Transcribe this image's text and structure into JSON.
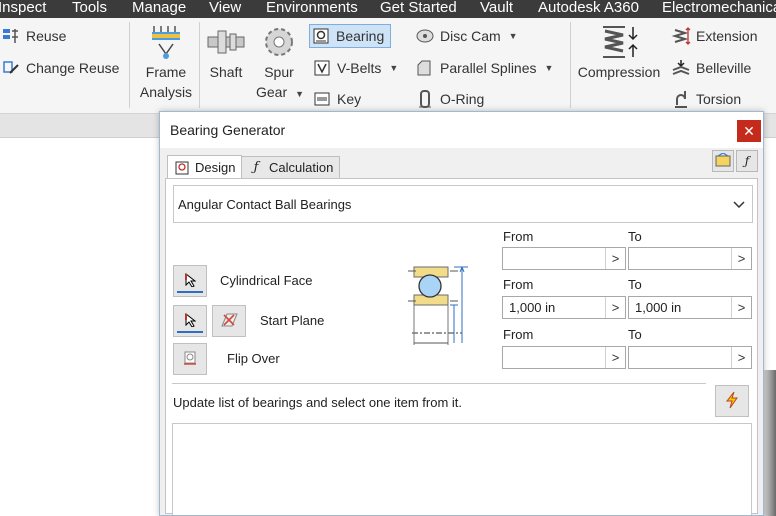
{
  "menubar": {
    "items": [
      "Inspect",
      "Tools",
      "Manage",
      "View",
      "Environments",
      "Get Started",
      "Vault",
      "Autodesk A360",
      "Electromechanica"
    ]
  },
  "ribbon": {
    "reuse": "Reuse",
    "change_reuse": "Change Reuse",
    "frame_analysis_1": "Frame",
    "frame_analysis_2": "Analysis",
    "shaft": "Shaft",
    "spur_gear_1": "Spur",
    "spur_gear_2": "Gear",
    "bearing": "Bearing",
    "v_belts": "V-Belts",
    "key": "Key",
    "disc_cam": "Disc Cam",
    "parallel_splines": "Parallel Splines",
    "o_ring": "O-Ring",
    "compression": "Compression",
    "extension": "Extension",
    "belleville": "Belleville",
    "torsion": "Torsion"
  },
  "dialog": {
    "title": "Bearing Generator",
    "close": "✕",
    "tabs": [
      {
        "label": "Design"
      },
      {
        "label": "Calculation"
      }
    ],
    "bearing_type": "Angular Contact Ball Bearings",
    "cylindrical_face": "Cylindrical Face",
    "start_plane": "Start Plane",
    "flip_over": "Flip Over",
    "ranges": [
      {
        "from_label": "From",
        "to_label": "To",
        "from_value": "",
        "to_value": ""
      },
      {
        "from_label": "From",
        "to_label": "To",
        "from_value": "1,000 in",
        "to_value": "1,000 in"
      },
      {
        "from_label": "From",
        "to_label": "To",
        "from_value": "",
        "to_value": ""
      }
    ],
    "hint": "Update list of bearings and select one item from it."
  },
  "colors": {
    "menubar_bg": "#3b3b3b",
    "active_button": "#cfe3f7",
    "close_red": "#c42b1c",
    "accent_blue": "#2f6fc0"
  }
}
